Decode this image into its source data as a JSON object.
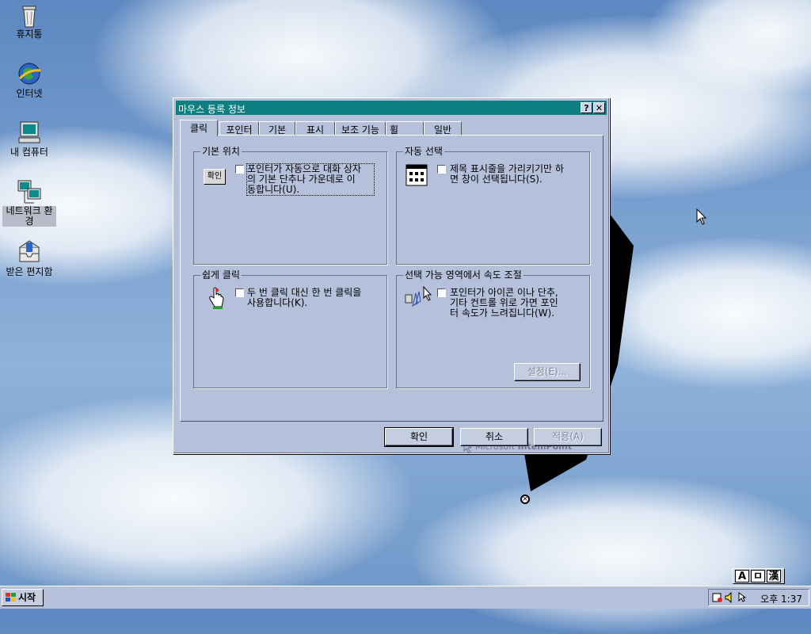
{
  "desktop": {
    "icons": [
      {
        "label": "휴지통",
        "icon": "recycle-bin-icon"
      },
      {
        "label": "인터넷",
        "icon": "internet-globe-icon"
      },
      {
        "label": "내 컴퓨터",
        "icon": "my-computer-icon"
      },
      {
        "label": "네트워크 환경",
        "icon": "network-icon",
        "selected": true
      },
      {
        "label": "받은 편지함",
        "icon": "inbox-icon"
      }
    ]
  },
  "dialog": {
    "title": "마우스 등록 정보",
    "help_glyph": "?",
    "close_glyph": "✕",
    "tabs": [
      {
        "label": "클릭",
        "active": true
      },
      {
        "label": "포인터"
      },
      {
        "label": "기본"
      },
      {
        "label": "표시"
      },
      {
        "label": "보조 기능"
      },
      {
        "label": "휠"
      },
      {
        "label": "일반"
      }
    ],
    "groups": {
      "basic_position": {
        "legend": "기본 위치",
        "icon_text": "확인",
        "text_line1": "포인터가 자동으로 대화 상자",
        "text_line2": "의 기본 단추나 가운데로 이",
        "text_line3": "동합니다(U).",
        "checked": false
      },
      "auto_select": {
        "legend": "자동 선택",
        "text_line1": "제목 표시줄을 가리키기만 하",
        "text_line2": "면 창이 선택됩니다(S).",
        "checked": false
      },
      "easy_click": {
        "legend": "쉽게 클릭",
        "text_line1": "두 번 클릭 대신 한 번 클릭을",
        "text_line2": "사용합니다(K).",
        "checked": false
      },
      "speed_adjust": {
        "legend": "선택 가능 영역에서 속도 조절",
        "text_line1": "포인터가 아이콘 이나 단추,",
        "text_line2": "기타 컨트롤 위로 가면 포인",
        "text_line3": "터 속도가 느려집니다(W).",
        "checked": false,
        "settings_button": "설정(E)..."
      }
    },
    "brand": {
      "prefix": "Microsoft",
      "name": "IntelliPoint"
    },
    "buttons": {
      "ok": "확인",
      "cancel": "취소",
      "apply": "적용(A)"
    }
  },
  "taskbar": {
    "start_label": "시작",
    "clock": "오후 1:37",
    "ime": [
      "A",
      "ㅁ",
      "漢"
    ]
  },
  "colors": {
    "titlebar": "#0e7f80",
    "face": "#b5c0da"
  }
}
